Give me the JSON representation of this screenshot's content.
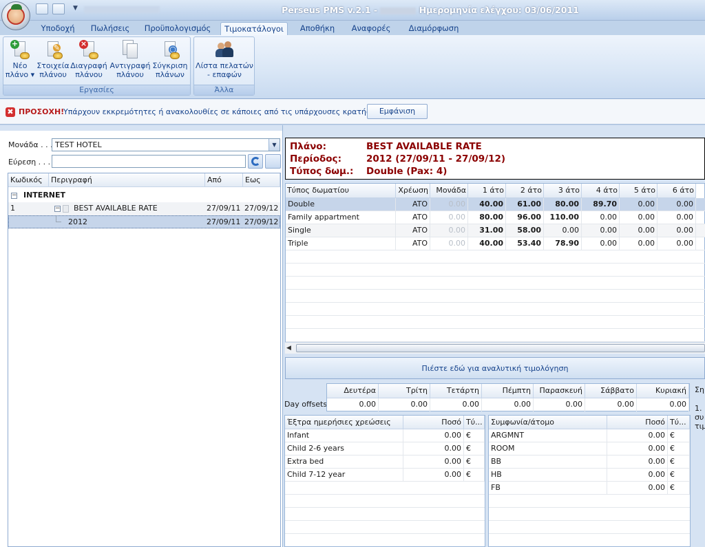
{
  "titlebar": {
    "app_title": "Perseus PMS v.2.1 - ",
    "date_label": "Ημερομηνία ελέγχου: 03/06/2011"
  },
  "tabs": [
    {
      "label": "Υποδοχή"
    },
    {
      "label": "Πωλήσεις"
    },
    {
      "label": "Προϋπολογισμός"
    },
    {
      "label": "Τιμοκατάλογοι"
    },
    {
      "label": "Αποθήκη"
    },
    {
      "label": "Αναφορές"
    },
    {
      "label": "Διαμόρφωση"
    }
  ],
  "active_tab": "Τιμοκατάλογοι",
  "ribbon": {
    "groups": [
      {
        "label": "Εργασίες",
        "buttons": [
          {
            "line1": "Νέο",
            "line2": "πλάνο ▾",
            "icon": "new-plan-icon"
          },
          {
            "line1": "Στοιχεία",
            "line2": "πλάνου",
            "icon": "plan-details-icon"
          },
          {
            "line1": "Διαγραφή",
            "line2": "πλάνου",
            "icon": "delete-plan-icon"
          },
          {
            "line1": "Αντιγραφή",
            "line2": "πλάνου",
            "icon": "copy-plan-icon"
          },
          {
            "line1": "Σύγκριση",
            "line2": "πλάνων",
            "icon": "compare-plans-icon"
          }
        ]
      },
      {
        "label": "Άλλα",
        "buttons": [
          {
            "line1": "Λίστα πελατών",
            "line2": "- επαφών",
            "icon": "contacts-list-icon"
          }
        ]
      }
    ]
  },
  "warning": {
    "strong": "ΠΡΟΣΟΧΗ!",
    "message": "Υπάρχουν εκκρεμότητες ή ανακολουθίες σε κάποιες από τις υπάρχουσες κρατήσεις.",
    "button": "Εμφάνιση"
  },
  "left": {
    "unit_label": "Μονάδα . . .",
    "unit_value": "TEST HOTEL",
    "search_label": "Εύρεση . . . .",
    "search_value": "",
    "tree_headers": [
      "Κωδικός",
      "Περιγραφή",
      "Από",
      "Εως"
    ],
    "tree": {
      "group": "INTERNET",
      "plan": {
        "code": "1",
        "description": "BEST AVAILABLE RATE",
        "from": "27/09/11",
        "to": "27/09/12"
      },
      "child": {
        "description": "2012",
        "from": "27/09/11",
        "to": "27/09/12"
      }
    }
  },
  "info": {
    "plan_label": "Πλάνο:",
    "plan_value": "BEST AVAILABLE RATE",
    "period_label": "Περίοδος:",
    "period_value": "2012 (27/09/11 - 27/09/12)",
    "room_type_label": "Τύπος δωμ.:",
    "room_type_value": "Double (Pax: 4)"
  },
  "price_grid": {
    "headers": [
      "Τύπος δωματίου",
      "Χρέωση",
      "Μονάδα",
      "1 άτο",
      "2 άτο",
      "3 άτο",
      "4 άτο",
      "5 άτο",
      "6 άτο"
    ],
    "rows": [
      {
        "room": "Double",
        "charge": "ATO",
        "unit": "0.00",
        "p1": "40.00",
        "p2": "61.00",
        "p3": "80.00",
        "p4": "89.70",
        "p5": "0.00",
        "p6": "0.00"
      },
      {
        "room": "Family appartment",
        "charge": "ATO",
        "unit": "0.00",
        "p1": "80.00",
        "p2": "96.00",
        "p3": "110.00",
        "p4": "0.00",
        "p5": "0.00",
        "p6": "0.00"
      },
      {
        "room": "Single",
        "charge": "ATO",
        "unit": "0.00",
        "p1": "31.00",
        "p2": "58.00",
        "p3": "0.00",
        "p4": "0.00",
        "p5": "0.00",
        "p6": "0.00"
      },
      {
        "room": "Triple",
        "charge": "ATO",
        "unit": "0.00",
        "p1": "40.00",
        "p2": "53.40",
        "p3": "78.90",
        "p4": "0.00",
        "p5": "0.00",
        "p6": "0.00"
      }
    ]
  },
  "detail_button": "Πιέστε εδώ για αναλυτική τιμολόγηση",
  "day_offsets": {
    "label": "Day offsets",
    "days": [
      "Δευτέρα",
      "Τρίτη",
      "Τετάρτη",
      "Πέμπτη",
      "Παρασκευή",
      "Σάββατο",
      "Κυριακή"
    ],
    "values": [
      "0.00",
      "0.00",
      "0.00",
      "0.00",
      "0.00",
      "0.00",
      "0.00"
    ]
  },
  "side_note": {
    "line1": "Ση",
    "line2": "1.",
    "line3": "συ",
    "line4": "τιμ"
  },
  "extra_charges": {
    "headers": [
      "Έξτρα ημερήσιες χρεώσεις",
      "Ποσό",
      "Τύ..."
    ],
    "rows": [
      {
        "name": "Infant",
        "amount": "0.00",
        "type": "€"
      },
      {
        "name": "Child 2-6 years",
        "amount": "0.00",
        "type": "€"
      },
      {
        "name": "Extra bed",
        "amount": "0.00",
        "type": "€"
      },
      {
        "name": "Child 7-12 year",
        "amount": "0.00",
        "type": "€"
      }
    ]
  },
  "agreements": {
    "headers": [
      "Συμφωνία/άτομο",
      "Ποσό",
      "Τύ..."
    ],
    "rows": [
      {
        "name": "ARGMNT",
        "amount": "0.00",
        "type": "€"
      },
      {
        "name": "ROOM",
        "amount": "0.00",
        "type": "€"
      },
      {
        "name": "BB",
        "amount": "0.00",
        "type": "€"
      },
      {
        "name": "HB",
        "amount": "0.00",
        "type": "€"
      },
      {
        "name": "FB",
        "amount": "0.00",
        "type": "€"
      }
    ]
  }
}
